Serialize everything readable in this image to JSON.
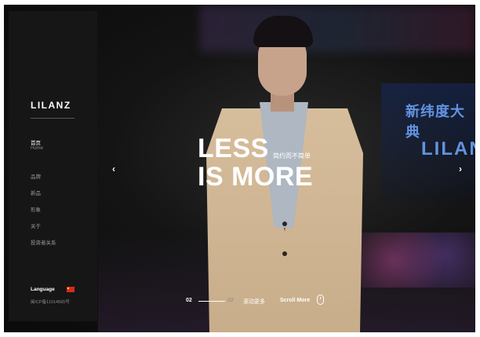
{
  "brand": {
    "logo": "LILANZ"
  },
  "nav": {
    "home_cn": "首页",
    "home_en": "Home",
    "items": [
      "品牌",
      "新品",
      "形象",
      "关于",
      "投资者关系"
    ]
  },
  "footer": {
    "language_label": "Language",
    "icp": "闽ICP备11014565号"
  },
  "hero": {
    "line1": "LESS",
    "line2": "IS MORE",
    "subtitle": "简约而不简单"
  },
  "backdrop": {
    "led_line1": "新纬度大典",
    "led_line2": "LILAN"
  },
  "pager": {
    "current": "02",
    "total": "02",
    "scroll_cn": "滚动更多",
    "scroll_en": "Scroll More"
  },
  "icons": [
    "chevron-left-icon",
    "chevron-right-icon",
    "mouse-icon",
    "china-flag-icon"
  ],
  "colors": {
    "sidebar": "#161616",
    "text": "#ffffff",
    "muted": "#9a9a9a"
  }
}
